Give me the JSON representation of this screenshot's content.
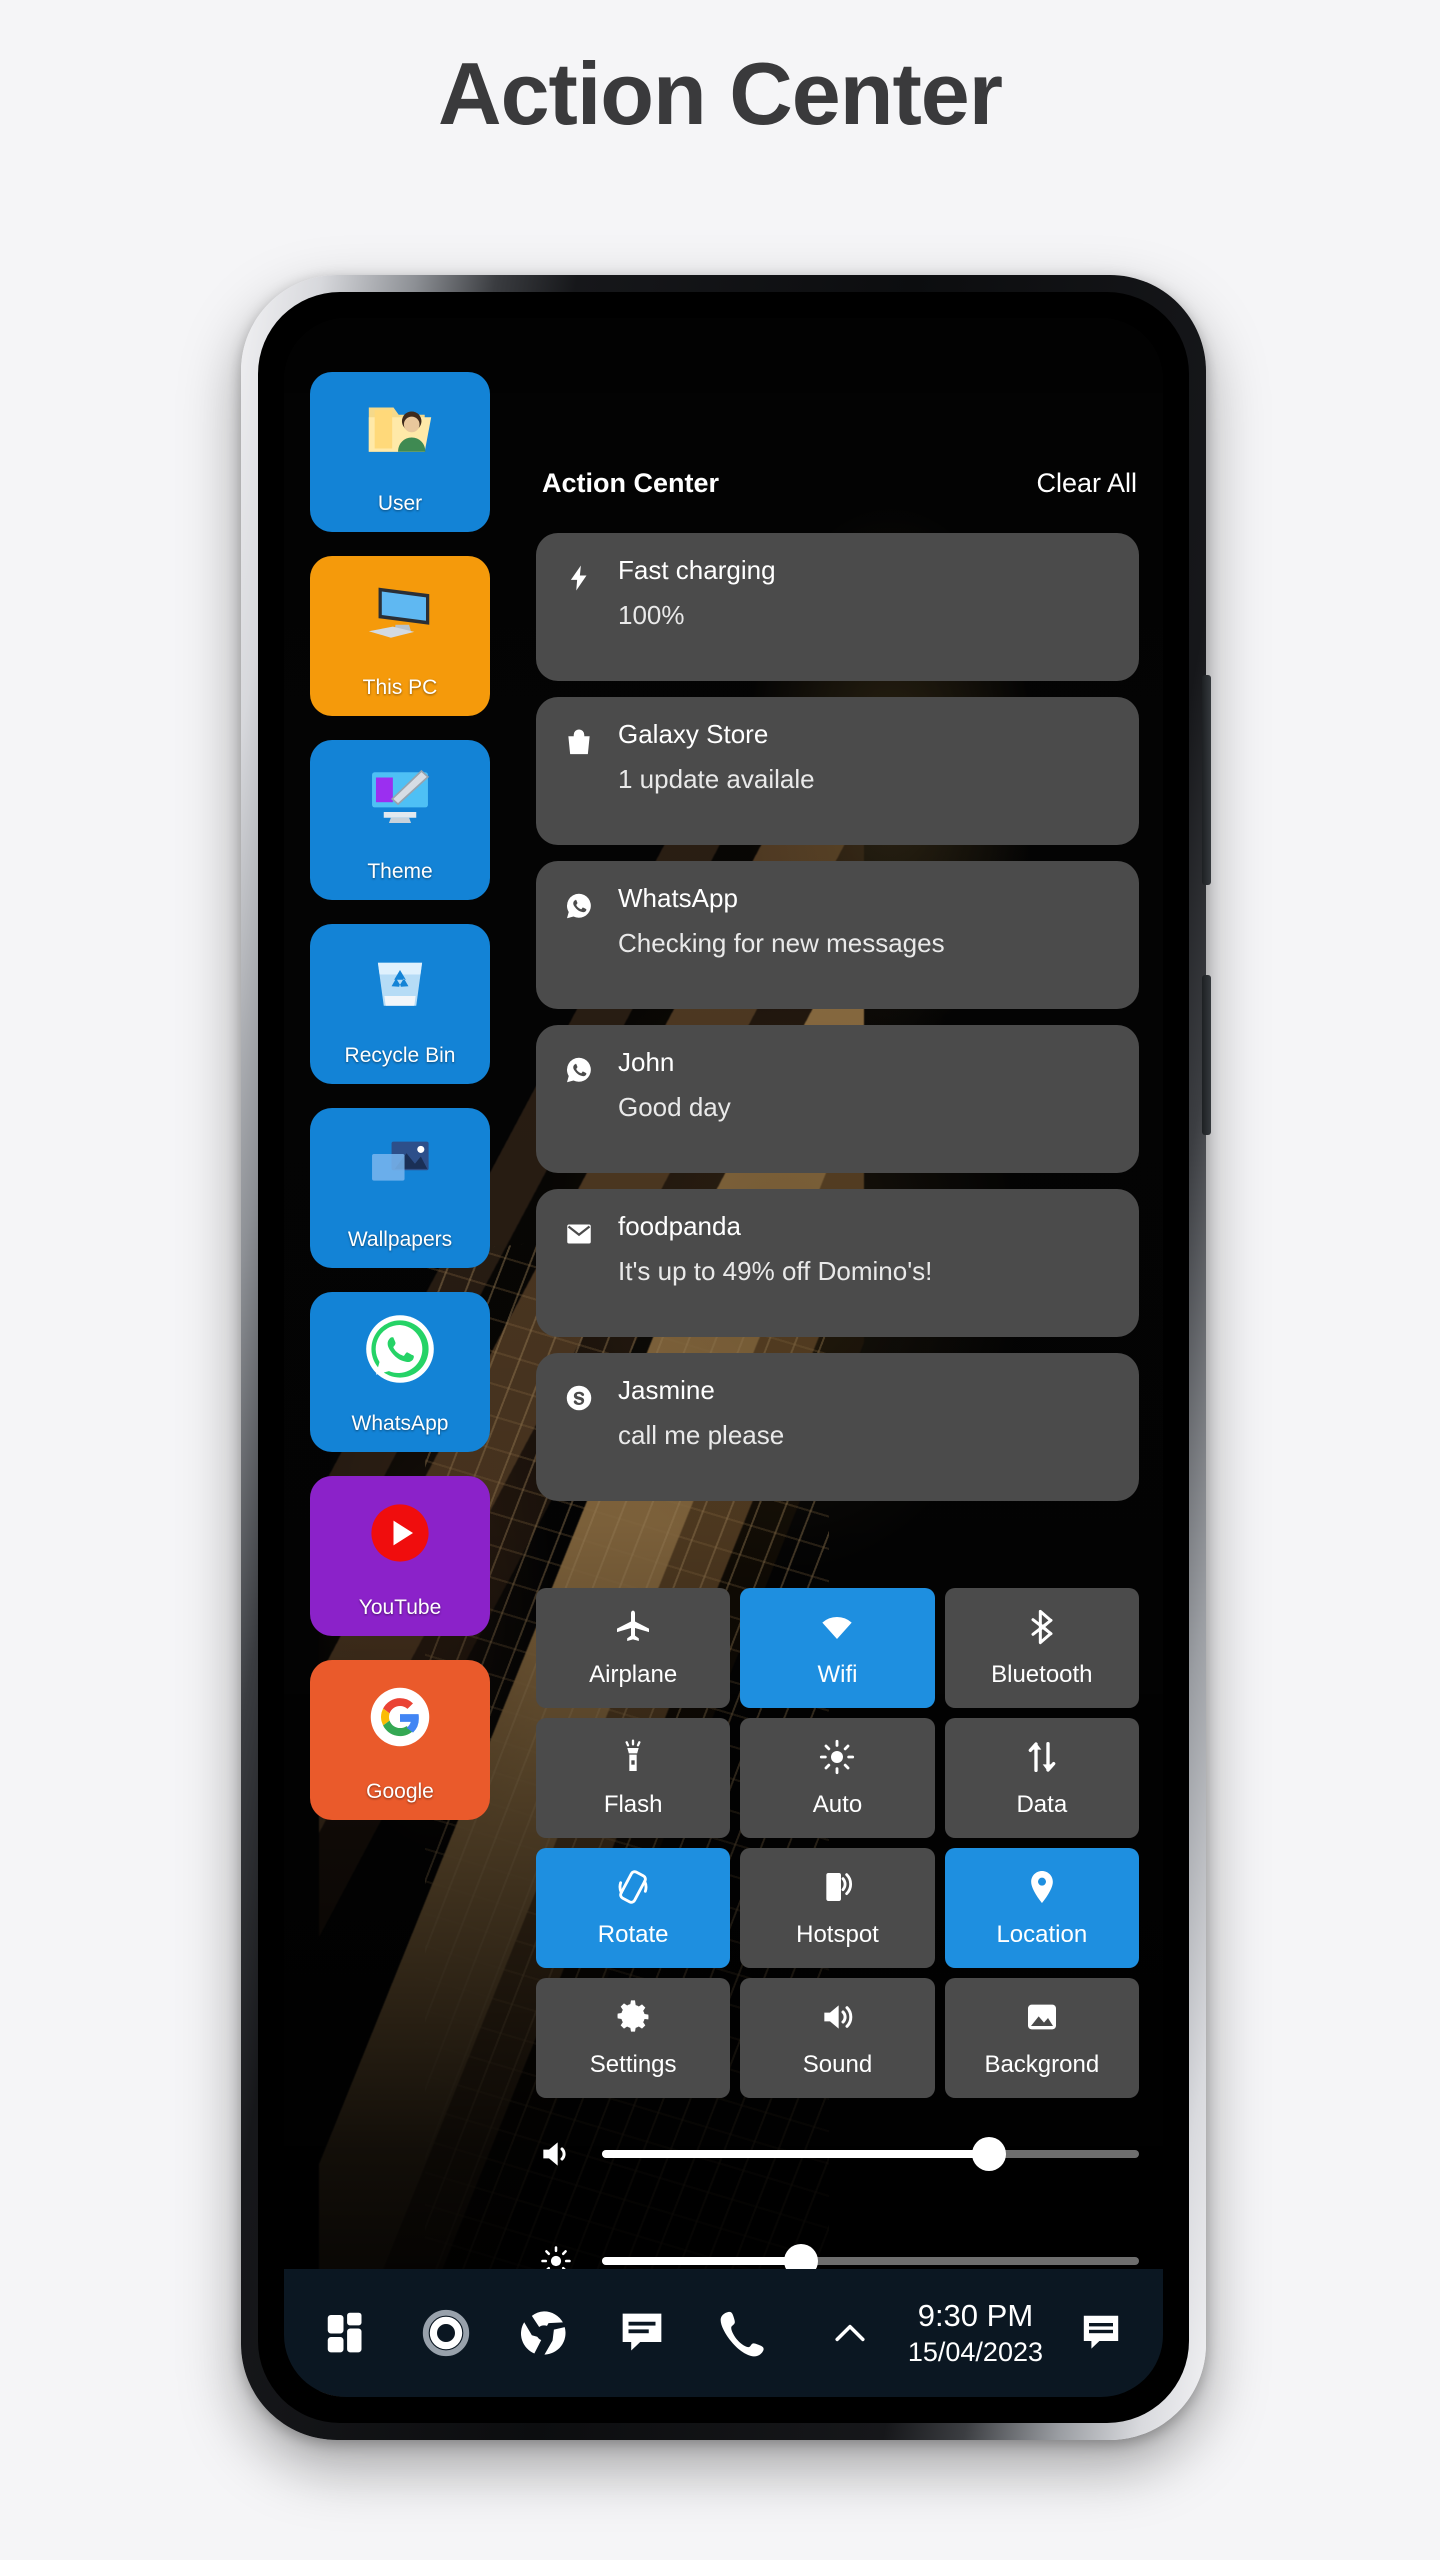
{
  "page": {
    "title": "Action Center"
  },
  "desktop_icons": [
    {
      "label": "User",
      "icon": "user-folder-icon",
      "bg": "#1383d6"
    },
    {
      "label": "This PC",
      "icon": "computer-icon",
      "bg": "#f59a0b"
    },
    {
      "label": "Theme",
      "icon": "theme-icon",
      "bg": "#1383d6"
    },
    {
      "label": "Recycle Bin",
      "icon": "recycle-bin-icon",
      "bg": "#1383d6"
    },
    {
      "label": "Wallpapers",
      "icon": "wallpapers-icon",
      "bg": "#1383d6"
    },
    {
      "label": "WhatsApp",
      "icon": "whatsapp-icon",
      "bg": "#1383d6"
    },
    {
      "label": "YouTube",
      "icon": "youtube-icon",
      "bg": "#8b22c9"
    },
    {
      "label": "Google",
      "icon": "google-icon",
      "bg": "#ea5a2b"
    }
  ],
  "action_center": {
    "title": "Action Center",
    "clear_all_label": "Clear All",
    "notifications": [
      {
        "icon": "bolt-icon",
        "title": "Fast charging",
        "body": "100%"
      },
      {
        "icon": "bag-icon",
        "title": "Galaxy Store",
        "body": "1 update availale"
      },
      {
        "icon": "whatsapp-icon",
        "title": "WhatsApp",
        "body": "Checking for new messages"
      },
      {
        "icon": "whatsapp-icon",
        "title": "John",
        "body": "Good day"
      },
      {
        "icon": "gmail-icon",
        "title": "foodpanda",
        "body": "It's up to 49% off Domino's!"
      },
      {
        "icon": "skype-icon",
        "title": "Jasmine",
        "body": "call me please"
      }
    ]
  },
  "quick_settings": {
    "active_color": "#1e8fe0",
    "inactive_color": "#4b4b4b",
    "tiles": [
      {
        "label": "Airplane",
        "icon": "airplane-icon",
        "active": false
      },
      {
        "label": "Wifi",
        "icon": "wifi-icon",
        "active": true
      },
      {
        "label": "Bluetooth",
        "icon": "bluetooth-icon",
        "active": false
      },
      {
        "label": "Flash",
        "icon": "flashlight-icon",
        "active": false
      },
      {
        "label": "Auto",
        "icon": "brightness-icon",
        "active": false
      },
      {
        "label": "Data",
        "icon": "data-icon",
        "active": false
      },
      {
        "label": "Rotate",
        "icon": "rotate-icon",
        "active": true
      },
      {
        "label": "Hotspot",
        "icon": "hotspot-icon",
        "active": false
      },
      {
        "label": "Location",
        "icon": "location-icon",
        "active": true
      },
      {
        "label": "Settings",
        "icon": "gear-icon",
        "active": false
      },
      {
        "label": "Sound",
        "icon": "sound-icon",
        "active": false
      },
      {
        "label": "Backgrond",
        "icon": "image-icon",
        "active": false
      }
    ]
  },
  "sliders": [
    {
      "name": "volume",
      "icon": "volume-icon",
      "percent": 72
    },
    {
      "name": "brightness",
      "icon": "brightness-icon",
      "percent": 37
    }
  ],
  "taskbar": {
    "icons": [
      {
        "icon": "start-icon"
      },
      {
        "icon": "cortana-icon"
      },
      {
        "icon": "chrome-icon"
      },
      {
        "icon": "messages-icon"
      },
      {
        "icon": "phone-icon"
      }
    ],
    "show_hidden_icon": "chevron-up-icon",
    "time": "9:30 PM",
    "date": "15/04/2023",
    "action_center_icon": "notification-icon"
  }
}
